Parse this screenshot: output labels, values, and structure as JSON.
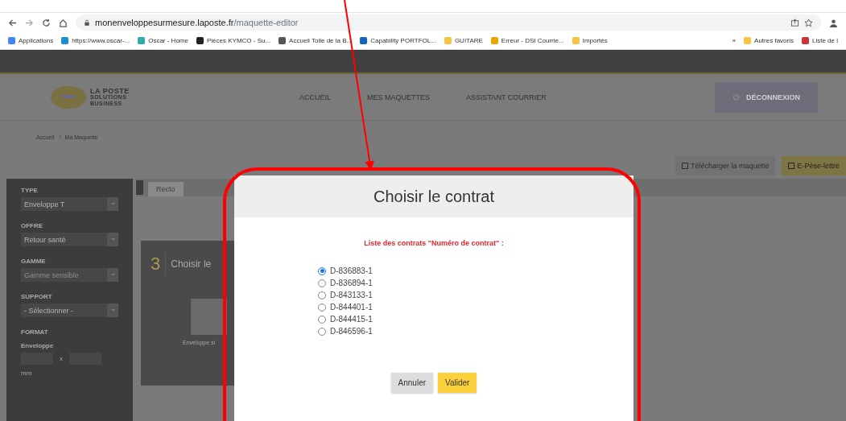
{
  "browser": {
    "address": {
      "host": "monenveloppesurmesure.laposte.fr",
      "path": "/maquette-editor"
    },
    "bookmarks": [
      "Applications",
      "https://www.oscar-...",
      "Oscar - Home",
      "Pièces KYMCO - Su...",
      "Accueil Toile de la B...",
      "Capability PORTFOL...",
      "GUITARE",
      "Erreur - DSI Courrie...",
      "Importés"
    ],
    "overflow": "»",
    "bookmarks_right": [
      "Autres favoris",
      "Liste de l"
    ]
  },
  "site": {
    "logo": [
      "LA POSTE",
      "SOLUTIONS",
      "BUSINESS"
    ],
    "nav": [
      "ACCUEIL",
      "MES MAQUETTES",
      "ASSISTANT COURRIER"
    ],
    "logout": "DÉCONNEXION",
    "breadcrumb": [
      "Accueil",
      "Ma Maquette"
    ],
    "toolbar": [
      {
        "label": "Télécharger la maquette",
        "kind": "plain"
      },
      {
        "label": "E-Pèse-lettre",
        "kind": "primary"
      }
    ]
  },
  "sidebar": {
    "sections": [
      {
        "label": "TYPE",
        "value": "Enveloppe T",
        "disabled": false
      },
      {
        "label": "OFFRE",
        "value": "Retour santé",
        "disabled": false
      },
      {
        "label": "GAMME",
        "value": "Gamme sensible",
        "disabled": true
      },
      {
        "label": "SUPPORT",
        "value": "- Sélectionner -",
        "disabled": false
      }
    ],
    "format": {
      "label": "FORMAT",
      "sublabel": "Enveloppe",
      "separator": "x",
      "unit": "mm"
    }
  },
  "content": {
    "tab": "Recto",
    "step": "3",
    "step_title": "Choisir le",
    "card_caption": "Enveloppe si"
  },
  "modal": {
    "title": "Choisir le contrat",
    "label": "Liste des contrats \"Numéro de contrat\" :",
    "options": [
      {
        "label": "D-836883-1",
        "selected": true
      },
      {
        "label": "D-836894-1",
        "selected": false
      },
      {
        "label": "D-843133-1",
        "selected": false
      },
      {
        "label": "D-844401-1",
        "selected": false
      },
      {
        "label": "D-844415-1",
        "selected": false
      },
      {
        "label": "D-846596-1",
        "selected": false
      }
    ],
    "buttons": [
      {
        "label": "Annuler",
        "kind": "secondary"
      },
      {
        "label": "Valider",
        "kind": "primary"
      }
    ]
  }
}
